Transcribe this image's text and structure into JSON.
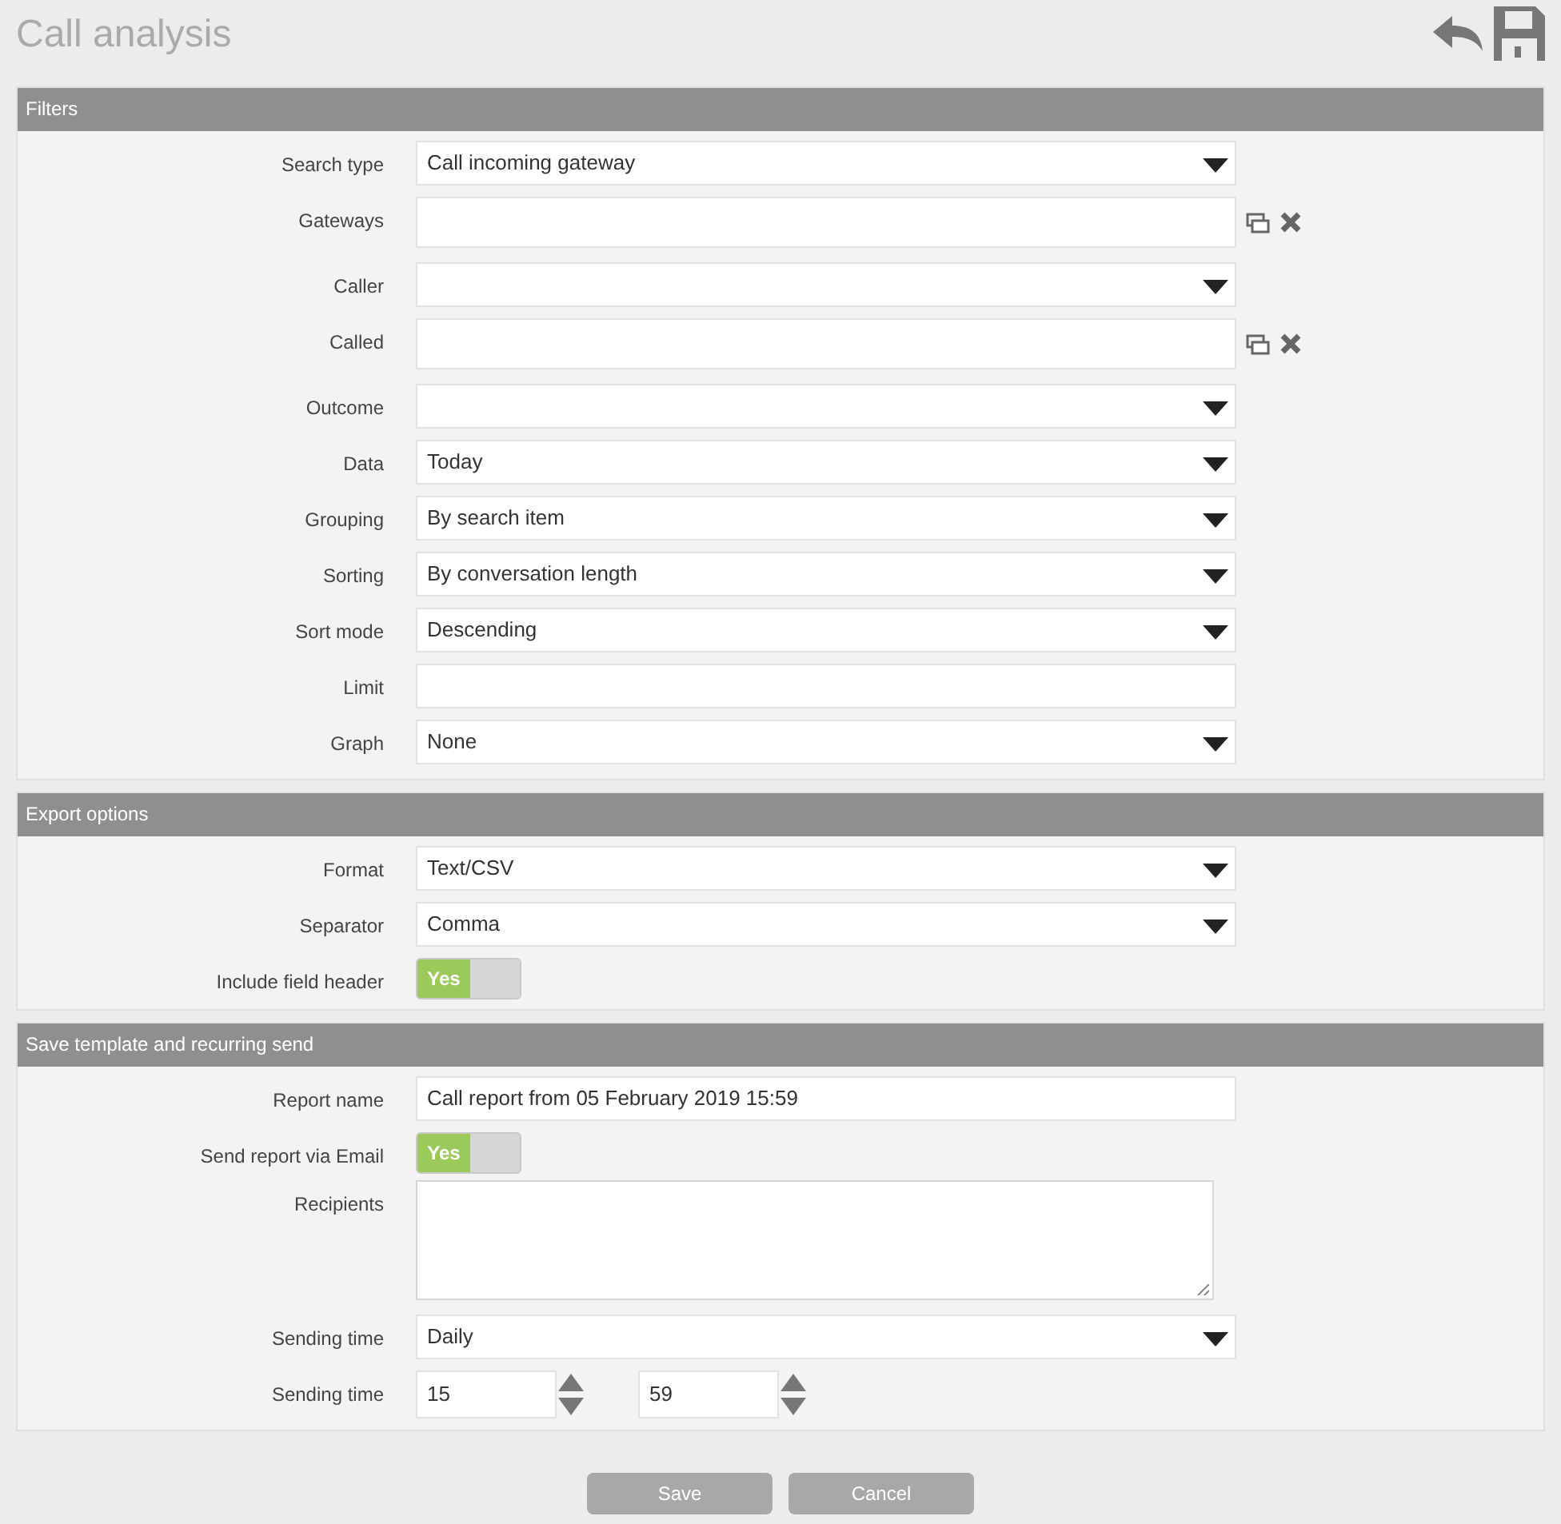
{
  "title": "Call analysis",
  "sections": [
    {
      "title": "Filters",
      "rows": [
        {
          "kind": "select",
          "label": "Search type",
          "value": "Call incoming gateway"
        },
        {
          "kind": "multi",
          "label": "Gateways"
        },
        {
          "kind": "select",
          "label": "Caller"
        },
        {
          "kind": "multi",
          "label": "Called"
        },
        {
          "kind": "select",
          "label": "Outcome"
        },
        {
          "kind": "select",
          "label": "Data",
          "value": "Today"
        },
        {
          "kind": "select",
          "label": "Grouping",
          "value": "By search item"
        },
        {
          "kind": "select",
          "label": "Sorting",
          "value": "By conversation length"
        },
        {
          "kind": "select",
          "label": "Sort mode",
          "value": "Descending"
        },
        {
          "kind": "text",
          "label": "Limit"
        },
        {
          "kind": "select",
          "label": "Graph",
          "value": "None"
        }
      ]
    },
    {
      "title": "Export options",
      "rows": [
        {
          "kind": "select",
          "label": "Format",
          "value": "Text/CSV"
        },
        {
          "kind": "select",
          "label": "Separator",
          "value": "Comma"
        },
        {
          "kind": "toggle",
          "label": "Include field header",
          "on": true,
          "on_text": "Yes"
        }
      ]
    },
    {
      "title": "Save template and recurring send",
      "rows": [
        {
          "kind": "text",
          "label": "Report name",
          "value": "Call report from 05 February 2019 15:59"
        },
        {
          "kind": "toggle",
          "label": "Send report via Email",
          "on": true,
          "on_text": "Yes"
        },
        {
          "kind": "textarea",
          "label": "Recipients"
        },
        {
          "kind": "select",
          "label": "Sending time",
          "value": "Daily"
        },
        {
          "kind": "spinners",
          "label": "Sending time",
          "values": [
            "15",
            "59"
          ]
        }
      ]
    }
  ],
  "buttons": [
    {
      "label": "Save"
    },
    {
      "label": "Cancel"
    }
  ]
}
